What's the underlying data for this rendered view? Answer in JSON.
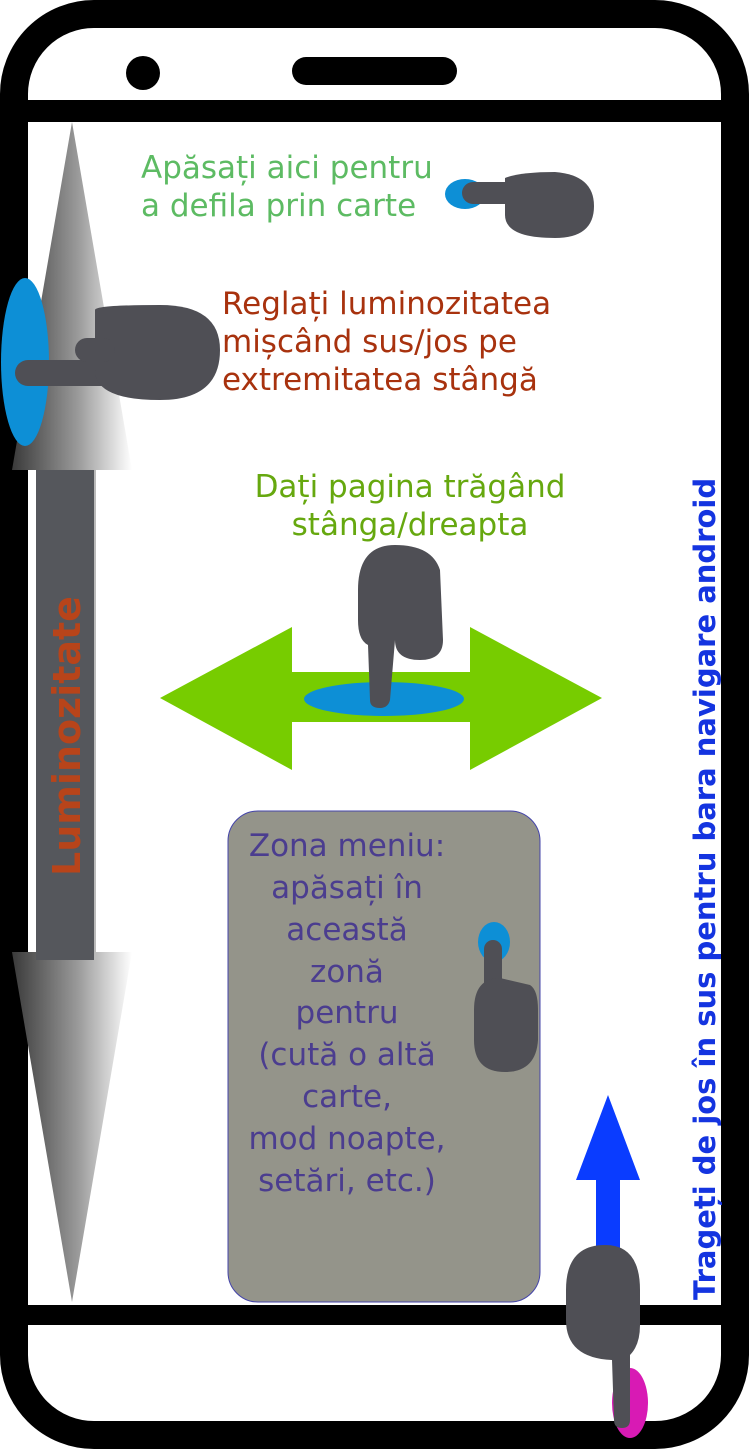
{
  "hints": {
    "scroll_line1": "Apăsați aici pentru",
    "scroll_line2": "a defila prin carte",
    "brightness_line1": "Reglați luminozitatea",
    "brightness_line2": "mișcând sus/jos pe",
    "brightness_line3": "extremitatea stângă",
    "page_line1": "Dați pagina trăgând",
    "page_line2": "stânga/dreapta",
    "menu_lines": [
      "Zona meniu:",
      "apăsați în",
      "această",
      "zonă",
      "pentru",
      "(cută o altă",
      "carte,",
      "mod noapte,",
      "setări, etc.)"
    ],
    "brightness_label": "Luminozitate",
    "nav_hint": "Trageți de jos în sus pentru bara navigare android"
  },
  "colors": {
    "scroll_text": "#5dbb63",
    "brightness_text": "#a8320e",
    "page_text": "#66a80f",
    "menu_text": "#4b3d8f",
    "menu_zone": "#94948a",
    "nav_text": "#1434e0",
    "touch_dot": "#0d8fd6",
    "pink_dot": "#d81ab4",
    "hand": "#4f4f55",
    "green_arrow": "#77cc00",
    "blue_arrow": "#0a3cff"
  }
}
